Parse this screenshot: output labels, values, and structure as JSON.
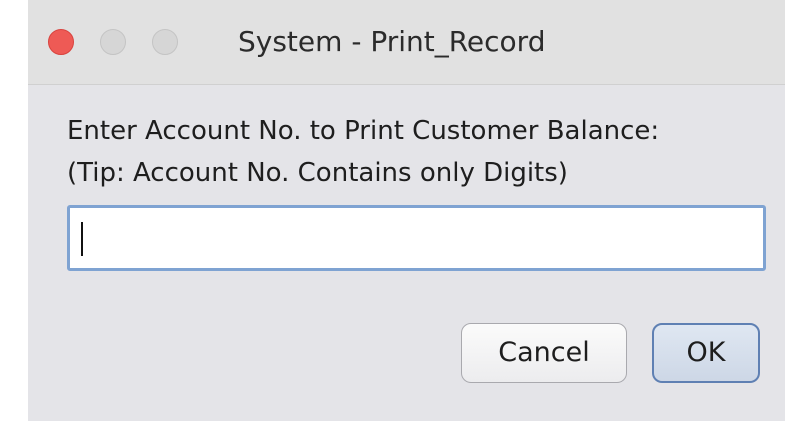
{
  "window": {
    "title": "System - Print_Record"
  },
  "dialog": {
    "prompt_line1": "Enter Account No. to Print Customer Balance:",
    "prompt_line2": "(Tip: Account No. Contains only Digits)",
    "account_input_value": ""
  },
  "buttons": {
    "cancel_label": "Cancel",
    "ok_label": "OK"
  },
  "colors": {
    "close_light": "#ee5a55",
    "inactive_light": "#d6d6d6",
    "input_focus_border": "#7fa3d2",
    "default_button_border": "#5f80b3",
    "dialog_background": "#e4e4e8"
  }
}
